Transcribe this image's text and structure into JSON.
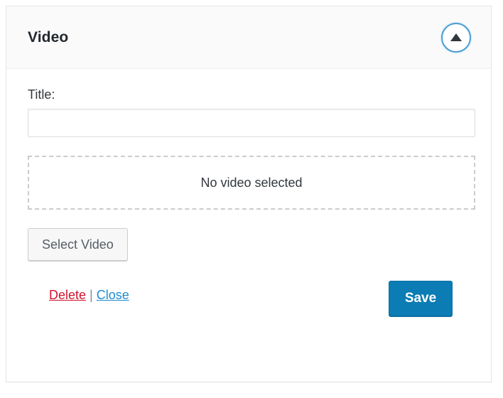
{
  "panel": {
    "header": {
      "title": "Video",
      "toggle_icon": "caret-up-icon",
      "toggle_accent_color": "#4a9fd4"
    },
    "form": {
      "title_field": {
        "label": "Title:",
        "value": "",
        "placeholder": ""
      },
      "media_dropzone": {
        "empty_text": "No video selected"
      },
      "select_media_button": {
        "label": "Select Video"
      }
    },
    "footer": {
      "delete_link": {
        "label": "Delete",
        "color": "#d2122e"
      },
      "separator": "|",
      "close_link": {
        "label": "Close",
        "color": "#1f8cce"
      },
      "save_button": {
        "label": "Save",
        "color": "#0b7cb4"
      }
    }
  }
}
